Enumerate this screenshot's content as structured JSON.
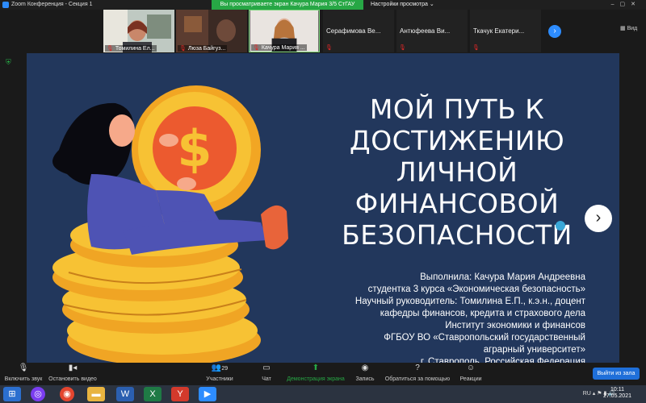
{
  "window": {
    "title": "Zoom Конференция - Секция 1"
  },
  "share_banner": "Вы просматриваете экран Качура Мария 3/5 СтГАУ",
  "view_options": "Настройки просмотра ⌄",
  "participants_video": [
    {
      "name": "Томилина Ел..."
    },
    {
      "name": "Люза Байгуз..."
    },
    {
      "name": "Качура Мария ..."
    }
  ],
  "participants_names": [
    {
      "name": "Серафимова  Ве..."
    },
    {
      "name": "Антюфеева  Ви..."
    },
    {
      "name": "Ткачук  Екатери..."
    }
  ],
  "view_label": "Вид",
  "slide": {
    "title_lines": [
      "МОЙ ПУТЬ К",
      "ДОСТИЖЕНИЮ",
      "ЛИЧНОЙ",
      "ФИНАНСОВОЙ",
      "БЕЗОПАСНОСТИ"
    ],
    "info_lines": [
      "Выполнила: Качура Мария Андреевна",
      "студентка 3 курса «Экономическая безопасность»",
      "Научный руководитель: Томилина Е.П., к.э.н., доцент",
      "кафедры финансов, кредита и страхового дела",
      "Институт экономики и финансов",
      "ФГБОУ ВО «Ставропольский государственный",
      "аграрный университет»",
      "г. Ставрополь, Российская Федерация"
    ],
    "background_color": "#22375c"
  },
  "toolbar": {
    "unmute": "Включить звук",
    "stop_video": "Остановить видео",
    "participants": "Участники",
    "participants_count": "29",
    "chat": "Чат",
    "share_screen": "Демонстрация экрана",
    "record": "Запись",
    "help": "Обратиться за помощью",
    "reactions": "Реакции",
    "leave": "Выйти из зала"
  },
  "taskbar": {
    "lang": "RU",
    "time": "10:11",
    "date": "27.05.2021"
  }
}
